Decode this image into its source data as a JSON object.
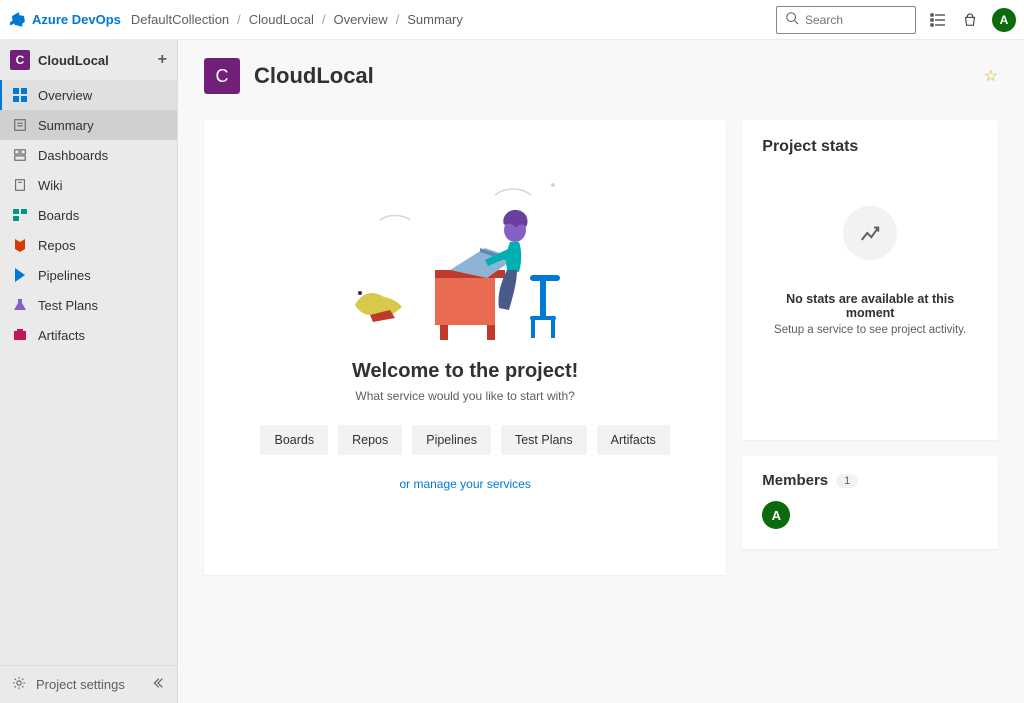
{
  "brand": "Azure DevOps",
  "breadcrumb": [
    "DefaultCollection",
    "CloudLocal",
    "Overview",
    "Summary"
  ],
  "search_placeholder": "Search",
  "user_initial": "A",
  "project": {
    "initial": "C",
    "name": "CloudLocal"
  },
  "sidebar": {
    "items": [
      {
        "label": "Overview",
        "icon": "overview",
        "active": true
      },
      {
        "label": "Summary",
        "icon": "summary",
        "selected": true
      },
      {
        "label": "Dashboards",
        "icon": "dashboards"
      },
      {
        "label": "Wiki",
        "icon": "wiki"
      },
      {
        "label": "Boards",
        "icon": "boards"
      },
      {
        "label": "Repos",
        "icon": "repos"
      },
      {
        "label": "Pipelines",
        "icon": "pipelines"
      },
      {
        "label": "Test Plans",
        "icon": "testplans"
      },
      {
        "label": "Artifacts",
        "icon": "artifacts"
      }
    ],
    "settings_label": "Project settings"
  },
  "page_title": "CloudLocal",
  "welcome": {
    "heading": "Welcome to the project!",
    "subheading": "What service would you like to start with?",
    "buttons": [
      "Boards",
      "Repos",
      "Pipelines",
      "Test Plans",
      "Artifacts"
    ],
    "manage_link": "or manage your services"
  },
  "stats": {
    "title": "Project stats",
    "message": "No stats are available at this moment",
    "sub": "Setup a service to see project activity."
  },
  "members": {
    "title": "Members",
    "count": "1",
    "initials": [
      "A"
    ]
  }
}
